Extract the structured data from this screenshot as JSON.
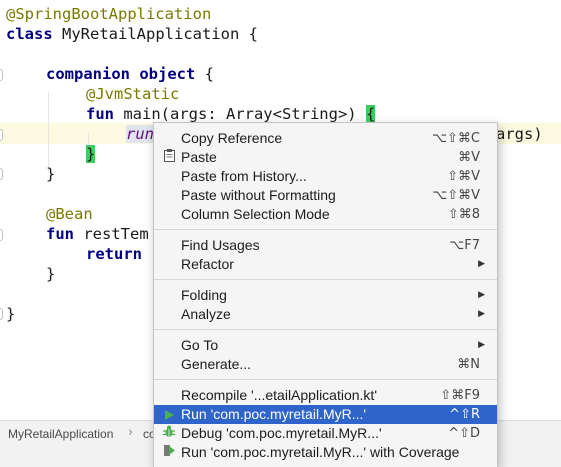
{
  "code": {
    "annotation_app": "@SpringBootApplication",
    "kw_class": "class",
    "class_decl": " MyRetailApplication {",
    "kw_companion": "companion",
    "kw_object": "object",
    "open_brace": " {",
    "annotation_jvm": "@JvmStatic",
    "kw_fun": "fun",
    "main_sig": " main(args: Array<String>) ",
    "brace_open": "{",
    "run_call": "run",
    "run_tail": "args)",
    "brace_close": "}",
    "close_brace": "}",
    "annotation_bean": "@Bean",
    "rest_sig": " restTem",
    "kw_return": "return",
    "final_brace": "}"
  },
  "breadcrumb": {
    "item1": "MyRetailApplication",
    "sep": "›",
    "item2": "co"
  },
  "menu": {
    "copy_reference": {
      "label": "Copy Reference",
      "shortcut": "⌥⇧⌘C"
    },
    "paste": {
      "label": "Paste",
      "shortcut": "⌘V",
      "icon": "clipboard-icon"
    },
    "paste_history": {
      "label": "Paste from History...",
      "shortcut": "⇧⌘V"
    },
    "paste_no_format": {
      "label": "Paste without Formatting",
      "shortcut": "⌥⇧⌘V"
    },
    "column_selection": {
      "label": "Column Selection Mode",
      "shortcut": "⇧⌘8"
    },
    "find_usages": {
      "label": "Find Usages",
      "shortcut": "⌥F7"
    },
    "refactor": {
      "label": "Refactor"
    },
    "folding": {
      "label": "Folding"
    },
    "analyze": {
      "label": "Analyze"
    },
    "go_to": {
      "label": "Go To"
    },
    "generate": {
      "label": "Generate...",
      "shortcut": "⌘N"
    },
    "recompile": {
      "label": "Recompile '...etailApplication.kt'",
      "shortcut": "⇧⌘F9"
    },
    "run": {
      "label": "Run 'com.poc.myretail.MyR...'",
      "shortcut": "^⇧R",
      "icon": "run-icon"
    },
    "debug": {
      "label": "Debug 'com.poc.myretail.MyR...'",
      "shortcut": "^⇧D",
      "icon": "debug-icon"
    },
    "run_coverage": {
      "label": "Run 'com.poc.myretail.MyR...' with Coverage",
      "icon": "coverage-icon"
    },
    "submenu_arrow": "▶"
  },
  "colors": {
    "selection": "#2f65ca",
    "keyword": "#000080",
    "annotation": "#7a7a00",
    "brace_match": "#3bcf5e",
    "current_line": "#fcfae0"
  }
}
